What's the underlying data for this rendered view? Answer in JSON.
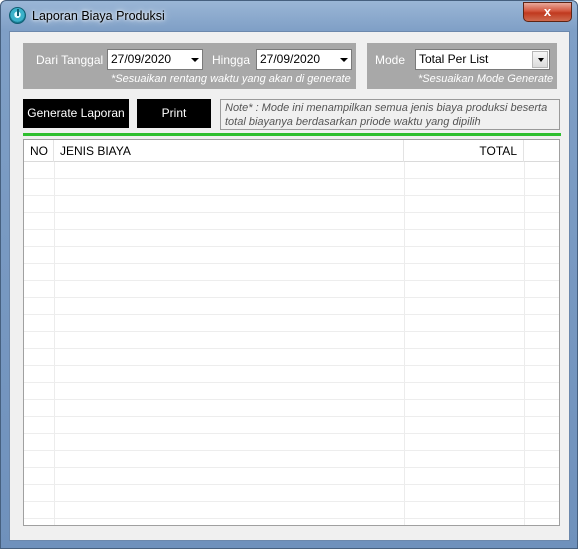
{
  "window": {
    "title": "Laporan Biaya Produksi",
    "close_label": "x"
  },
  "filters": {
    "from_label": "Dari Tanggal",
    "from_value": "27/09/2020",
    "to_label": "Hingga",
    "to_value": "27/09/2020",
    "range_hint": "*Sesuaikan rentang waktu yang akan di generate"
  },
  "mode": {
    "label": "Mode",
    "value": "Total Per List",
    "hint": "*Sesuaikan Mode Generate"
  },
  "actions": {
    "generate_label": "Generate Laporan",
    "print_label": "Print"
  },
  "note": {
    "text": "Note* : Mode ini menampilkan semua jenis biaya produksi beserta total biayanya berdasarkan priode waktu yang dipilih"
  },
  "table": {
    "columns": [
      "NO",
      "JENIS BIAYA",
      "TOTAL"
    ],
    "rows": []
  },
  "colors": {
    "accent_line": "#2fbf2f",
    "panel_bg": "#a8a8a8",
    "button_bg": "#000000",
    "close_button": "#c0391f"
  }
}
